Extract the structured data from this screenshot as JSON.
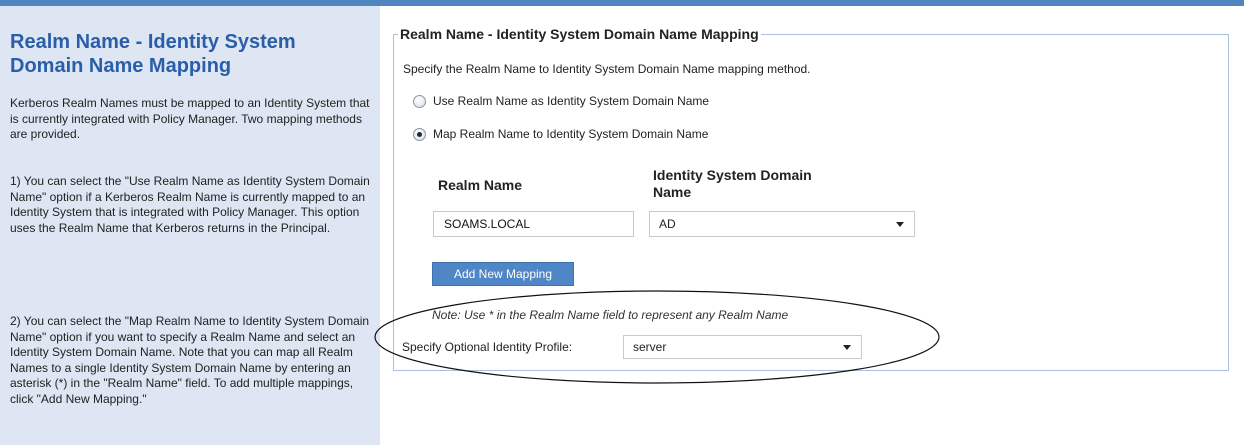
{
  "help": {
    "title": "Realm Name - Identity System Domain Name Mapping",
    "para1": "Kerberos Realm Names must be mapped to an Identity System that is currently integrated with Policy Manager. Two mapping methods are provided.",
    "para2": "1) You can select the \"Use Realm Name as Identity System Domain Name\" option if a Kerberos Realm Name is currently mapped to an Identity System that is integrated with Policy Manager. This option uses the Realm Name that Kerberos returns in the Principal.",
    "para3": "2) You can select the \"Map Realm Name to Identity System Domain Name\" option if you want to specify a Realm Name and select an Identity System Domain Name. Note that you can map all Realm Names to a single Identity System Domain Name by entering an asterisk (*) in the \"Realm Name\" field. To add multiple mappings, click \"Add New Mapping.\""
  },
  "form": {
    "legend": "Realm Name - Identity System Domain Name Mapping",
    "instruction": "Specify the Realm Name to Identity System Domain Name mapping method.",
    "options": [
      {
        "label": "Use Realm Name as Identity System Domain Name",
        "selected": false
      },
      {
        "label": "Map Realm Name to Identity System Domain Name",
        "selected": true
      }
    ],
    "columns": {
      "realm_name": "Realm Name",
      "domain_name_line1": "Identity System Domain",
      "domain_name_line2": "Name"
    },
    "rows": [
      {
        "realm_name": "SOAMS.LOCAL",
        "domain_name": "AD"
      }
    ],
    "add_button": "Add New Mapping",
    "note": "Note: Use * in the Realm Name field to represent any Realm Name",
    "profile_label": "Specify Optional Identity Profile:",
    "profile_value": "server"
  },
  "colors": {
    "accent": "#4f86c0",
    "panel_bg": "#dde6f2",
    "title_blue": "#2a5ea8",
    "button_bg": "#4f86c6"
  }
}
